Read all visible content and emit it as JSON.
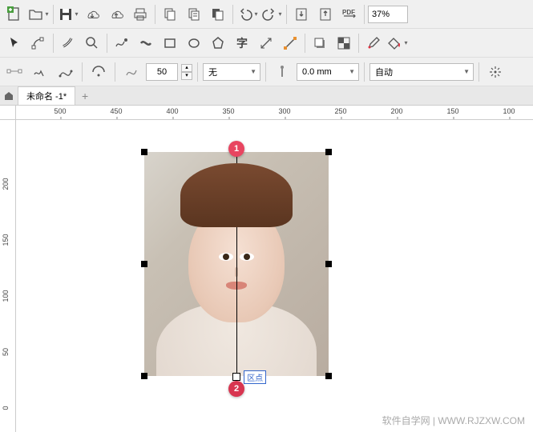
{
  "toolbar1": {
    "zoom_value": "37%"
  },
  "toolbar2": {},
  "propbar": {
    "spin_value": "50",
    "corner_style": "无",
    "outline_width": "0.0 mm",
    "auto_label": "自动"
  },
  "tabs": {
    "active_tab": "未命名 -1*"
  },
  "ruler_top": [
    "500",
    "450",
    "400",
    "350",
    "300",
    "250",
    "200",
    "150",
    "100"
  ],
  "ruler_left": [
    "200",
    "150",
    "100",
    "50",
    "0"
  ],
  "markers": {
    "m1": "1",
    "m2": "2",
    "node_tooltip": "区点"
  },
  "watermark": "软件自学网 | WWW.RJZXW.COM",
  "colors": {
    "marker": "#e84560",
    "accent": "#3366cc"
  }
}
